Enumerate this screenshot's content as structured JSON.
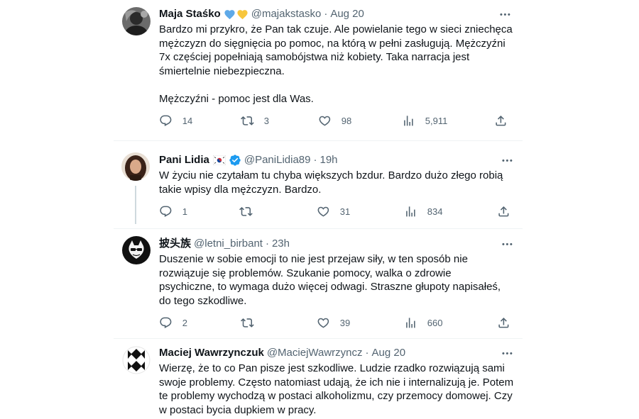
{
  "tweets": [
    {
      "name": "Maja Staśko",
      "handle": "@majakstasko",
      "time": "Aug 20",
      "badges": [
        "blue-heart",
        "yellow-heart"
      ],
      "text": "Bardzo mi przykro, że Pan tak czuje. Ale powielanie tego w sieci zniechęca mężczyzn do sięgnięcia po pomoc, na którą w pełni zasługują. Mężczyźni 7x częściej popełniają samobójstwa niż kobiety. Taka narracja jest śmiertelnie niebezpieczna.\n\nMężczyźni - pomoc jest dla Was.",
      "replies": "14",
      "retweets": "3",
      "likes": "98",
      "views": "5,911"
    },
    {
      "name": "Pani Lidia",
      "handle": "@PaniLidia89",
      "time": "19h",
      "badges": [
        "flag-south-korea",
        "verified-check"
      ],
      "text": "W życiu nie czytałam tu chyba większych bzdur. Bardzo dużo złego robią takie wpisy dla mężczyzn. Bardzo.",
      "replies": "1",
      "retweets": "",
      "likes": "31",
      "views": "834"
    },
    {
      "name": "披头族",
      "handle": "@letni_birbant",
      "time": "23h",
      "badges": [],
      "text": "Duszenie w sobie emocji to nie jest przejaw siły, w ten sposób nie rozwiązuje się problemów. Szukanie pomocy, walka o zdrowie psychiczne, to wymaga dużo więcej odwagi. Straszne głupoty napisałeś, do tego szkodliwe.",
      "replies": "2",
      "retweets": "",
      "likes": "39",
      "views": "660"
    },
    {
      "name": "Maciej Wawrzynczuk",
      "handle": "@MaciejWawrzyncz",
      "time": "Aug 20",
      "badges": [],
      "text": "Wierzę, że to co Pan pisze jest szkodliwe. Ludzie rzadko rozwiązują sami swoje problemy. Często natomiast udają, że ich nie i internalizują je. Potem te problemy wychodzą w postaci alkoholizmu, czy przemocy domowej. Czy w postaci bycia dupkiem w pracy.",
      "replies": "",
      "retweets": "",
      "likes": "",
      "views": ""
    }
  ],
  "dot_separator": "·",
  "colors": {
    "text": "#0f1419",
    "secondary": "#536471",
    "verified": "#1d9bf0",
    "divider": "#eff3f4",
    "thread_line": "#cfd9de"
  },
  "icons": {
    "reply": "speech-bubble-icon",
    "retweet": "retweet-arrows-icon",
    "like": "heart-outline-icon",
    "views": "bar-chart-icon",
    "share": "upload-share-icon",
    "more": "more-dots-icon"
  }
}
